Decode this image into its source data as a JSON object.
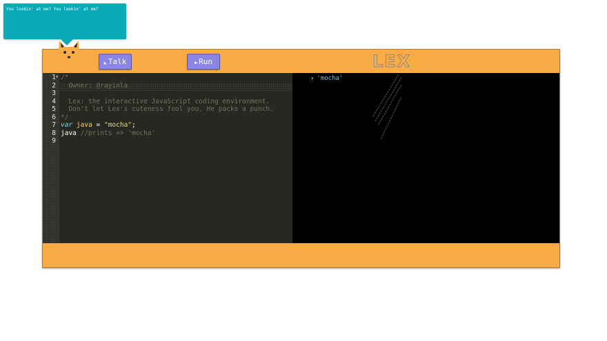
{
  "bubble": {
    "text": "You lookin' at me? You lookin' at me?"
  },
  "toolbar": {
    "talk_label": "Talk",
    "talk_icon": "rss-icon",
    "run_label": "Run",
    "run_icon": "play-icon"
  },
  "logo": {
    "text": "LEX"
  },
  "editor": {
    "line_numbers": "1\n2\n3\n4\n5\n6\n7\n8\n9",
    "lines": {
      "l1": "/*",
      "l2": "  Owner: @rayinla",
      "l3": "",
      "l4": "  Lex: the interactive JavaScript coding environment.",
      "l5": "  Don't let Lex's cuteness fool you. He packs a punch.",
      "l6": "*/",
      "l7": {
        "keyword": "var",
        "name": "java",
        "op": " = ",
        "string": "\"mocha\"",
        "end": ";"
      },
      "l8": {
        "name": "java",
        "comment": " //prints => 'mocha'"
      },
      "l9": ""
    }
  },
  "console": {
    "output": "'mocha'"
  },
  "colors": {
    "app_bg": "#f9ac45",
    "button": "#8b85e6",
    "bubble": "#0aa9b8",
    "editor_bg": "#272822",
    "console_bg": "#000000"
  }
}
